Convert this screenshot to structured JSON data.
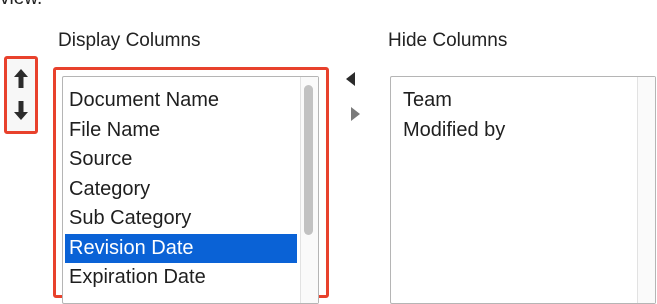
{
  "clipped_title": "view.",
  "display_columns": {
    "heading": "Display Columns",
    "items": [
      {
        "label": "Document Name",
        "selected": false
      },
      {
        "label": "File Name",
        "selected": false
      },
      {
        "label": "Source",
        "selected": false
      },
      {
        "label": "Category",
        "selected": false
      },
      {
        "label": "Sub Category",
        "selected": false
      },
      {
        "label": "Revision Date",
        "selected": true
      },
      {
        "label": "Expiration Date",
        "selected": false
      }
    ]
  },
  "hide_columns": {
    "heading": "Hide Columns",
    "items": [
      {
        "label": "Team",
        "selected": false
      },
      {
        "label": "Modified by",
        "selected": false
      }
    ]
  },
  "icons": {
    "move_up": "arrow-up-icon",
    "move_down": "arrow-down-icon",
    "move_to_display": "triangle-left-icon",
    "move_to_hide": "triangle-right-icon"
  },
  "colors": {
    "highlight_border": "#e8412c",
    "selection": "#0a62d6",
    "arrow_active": "#2b2b2b",
    "arrow_inactive": "#7a7a7a"
  }
}
